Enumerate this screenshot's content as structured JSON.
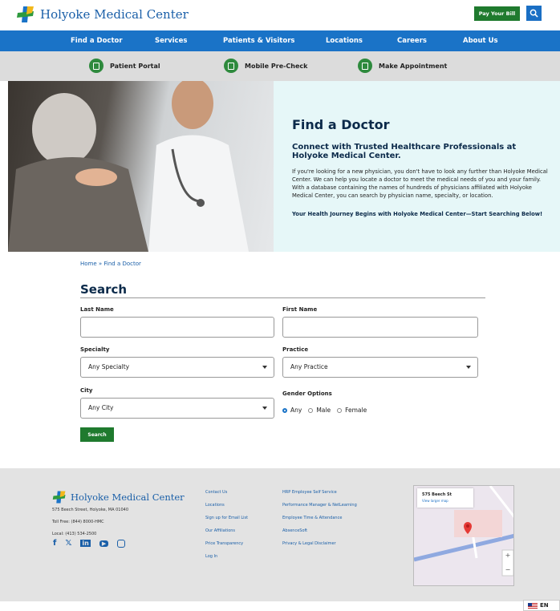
{
  "header": {
    "brand": "Holyoke Medical Center",
    "pay_bill": "Pay Your Bill",
    "search_icon": "search-icon"
  },
  "mainnav": [
    "Find a Doctor",
    "Services",
    "Patients & Visitors",
    "Locations",
    "Careers",
    "About Us"
  ],
  "subnav": [
    {
      "label": "Patient Portal",
      "icon": "portal-icon"
    },
    {
      "label": "Mobile Pre-Check",
      "icon": "phone-icon"
    },
    {
      "label": "Make Appointment",
      "icon": "appointment-icon"
    }
  ],
  "hero": {
    "title": "Find a Doctor",
    "subtitle": "Connect with Trusted Healthcare Professionals at Holyoke Medical Center.",
    "body": "If you're looking for a new physician, you don't have to look any further than Holyoke Medical Center. We can help you locate a doctor to meet the medical needs of you and your family. With a database containing the names of hundreds of physicians affiliated with Holyoke Medical Center, you can search by physician name, specialty, or location.",
    "cta": "Your Health Journey Begins with Holyoke Medical Center—Start Searching Below!"
  },
  "breadcrumb": "Home » Find a Doctor",
  "search": {
    "title": "Search",
    "last_name_label": "Last Name",
    "first_name_label": "First Name",
    "specialty_label": "Specialty",
    "specialty_value": "Any Specialty",
    "practice_label": "Practice",
    "practice_value": "Any Practice",
    "city_label": "City",
    "city_value": "Any City",
    "gender_label": "Gender Options",
    "gender_options": [
      "Any",
      "Male",
      "Female"
    ],
    "submit": "Search"
  },
  "footer": {
    "brand": "Holyoke Medical Center",
    "address": "575 Beech Street, Holyoke, MA 01040",
    "toll_free": "Toll Free: (844) 8000-HMC",
    "local": "Local: (413) 534-2500",
    "col1": [
      "Contact Us",
      "Locations",
      "Sign up for Email List",
      "Our Affiliations",
      "Price Transparency",
      "Log In"
    ],
    "col2": [
      "HRP Employee Self Service",
      "Performance Manager & NetLearning",
      "Employee Time & Attendance",
      "AbsenceSoft",
      "Privacy & Legal Disclaimer"
    ],
    "map_title": "575 Beech St",
    "map_link": "View larger map",
    "social_icons": [
      "facebook-icon",
      "x-icon",
      "linkedin-icon",
      "youtube-icon",
      "instagram-icon"
    ]
  },
  "language": "EN"
}
